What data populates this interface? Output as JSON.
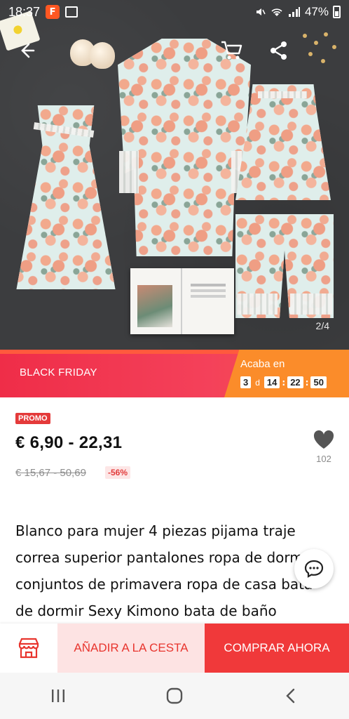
{
  "status_bar": {
    "time": "18:37",
    "app_badge": "F",
    "battery": "47%"
  },
  "gallery": {
    "counter": "2/4"
  },
  "banner": {
    "label": "BLACK FRIDAY",
    "ends_label": "Acaba en",
    "days": "3",
    "days_unit": "d",
    "hours": "14",
    "minutes": "22",
    "seconds": "50"
  },
  "product": {
    "promo_badge": "PROMO",
    "price": "€ 6,90 - 22,31",
    "old_price": "€ 15,67 - 50,69",
    "discount": "-56%",
    "wishlist_count": "102",
    "title": "Blanco para mujer 4 piezas pijama traje correa superior pantalones ropa de dormir conjuntos de primavera ropa de casa bata de dormir Sexy Kimono bata de baño"
  },
  "actions": {
    "add_to_cart": "AÑADIR A LA CESTA",
    "buy_now": "COMPRAR AHORA"
  },
  "icons": {
    "back": "back-arrow-icon",
    "cart": "cart-icon",
    "share": "share-icon",
    "heart": "heart-icon",
    "chat": "chat-icon",
    "store": "store-icon"
  },
  "colors": {
    "accent": "#f0393a",
    "banner_red": "#ef2d48",
    "banner_orange": "#fb8c2a",
    "add_cart_bg": "#fde3e3"
  }
}
